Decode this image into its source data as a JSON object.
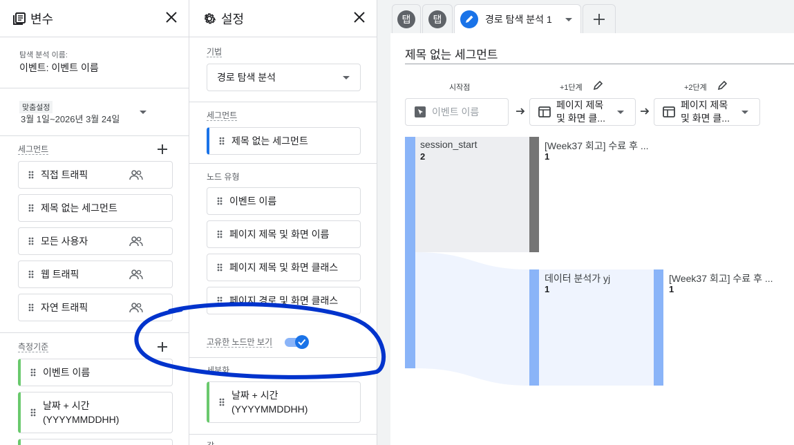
{
  "variables": {
    "title": "변수",
    "exploration_name_label": "탐색 분석 이름:",
    "exploration_name": "이벤트: 이벤트 이름",
    "date_label": "맞춤설정",
    "date_range": "3월 1일~2026년 3월 24일",
    "segments_label": "세그먼트",
    "segments": [
      "직접 트래픽",
      "제목 없는 세그먼트",
      "모든 사용자",
      "웹 트래픽",
      "자연 트래픽"
    ],
    "dimensions_label": "측정기준",
    "dimensions": [
      "이벤트 이름",
      "날짜 + 시간",
      "(YYYYMMDDHH)"
    ]
  },
  "settings": {
    "title": "설정",
    "technique_label": "기법",
    "technique_value": "경로 탐색 분석",
    "segment_label": "세그먼트",
    "segment_value": "제목 없는 세그먼트",
    "node_type_label": "노드 유형",
    "node_types": [
      "이벤트 이름",
      "페이지 제목 및 화면 이름",
      "페이지 제목 및 화면 클래스",
      "페이지 경로 및 화면 클래스"
    ],
    "unique_nodes_label": "고유한 노드만 보기",
    "unique_nodes_on": true,
    "breakdown_label": "세분화",
    "breakdown_line1": "날짜 + 시간",
    "breakdown_line2": "(YYYYMMDDHH)",
    "values_label": "값"
  },
  "tabs": {
    "tab1": "탭",
    "tab2": "탭",
    "active_tab": "경로 탐색 분석 1"
  },
  "canvas": {
    "segment_title": "제목 없는 세그먼트",
    "start_label": "시작점",
    "step1_label": "+1단계",
    "step2_label": "+2단계",
    "start_node": "이벤트 이름",
    "step1_node_line1": "페이지 제목",
    "step1_node_line2": "및 화면 클...",
    "step2_node_line1": "페이지 제목",
    "step2_node_line2": "및 화면 클...",
    "flow_start_name": "session_start",
    "flow_start_value": "2",
    "flow1a_name": "[Week37 회고] 수료 후 ...",
    "flow1a_value": "1",
    "flow1b_name": "데이터 분석가 yj",
    "flow1b_value": "1",
    "flow2_name": "[Week37 회고] 수료 후 ...",
    "flow2_value": "1"
  },
  "colors": {
    "accent": "#1a73e8",
    "green": "#6ac96d",
    "flowbar": "#8ab4f8",
    "grey_bar": "#757575",
    "annotation": "#0033cc"
  }
}
